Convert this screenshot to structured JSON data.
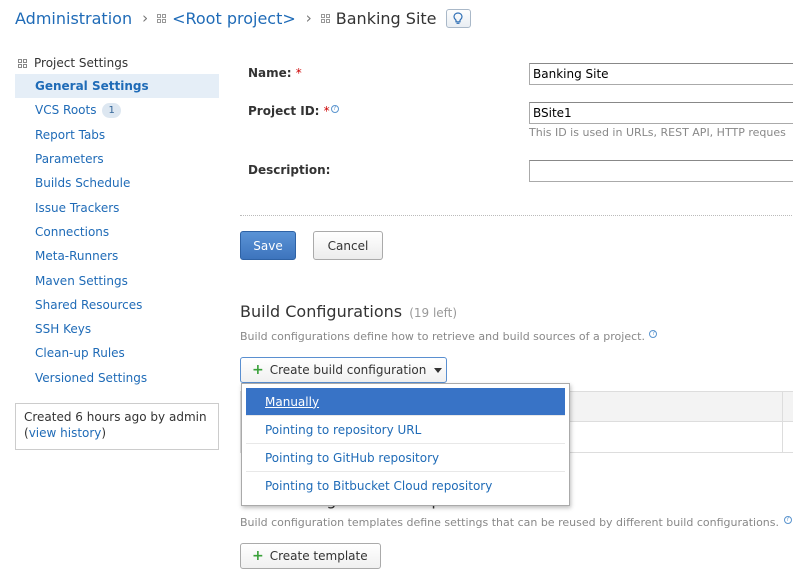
{
  "breadcrumb": {
    "admin": "Administration",
    "root": "<Root project>",
    "current": "Banking Site",
    "separator": "›"
  },
  "sidebar": {
    "header": "Project Settings",
    "items": [
      {
        "label": "General Settings",
        "active": true
      },
      {
        "label": "VCS Roots",
        "badge": "1"
      },
      {
        "label": "Report Tabs"
      },
      {
        "label": "Parameters"
      },
      {
        "label": "Builds Schedule"
      },
      {
        "label": "Issue Trackers"
      },
      {
        "label": "Connections"
      },
      {
        "label": "Meta-Runners"
      },
      {
        "label": "Maven Settings"
      },
      {
        "label": "Shared Resources"
      },
      {
        "label": "SSH Keys"
      },
      {
        "label": "Clean-up Rules"
      },
      {
        "label": "Versioned Settings"
      }
    ],
    "info": {
      "created": "Created 6 hours ago  by admin",
      "open_paren": "(",
      "history_link": "view history",
      "close_paren": ")"
    }
  },
  "form": {
    "name_label": "Name:",
    "name_value": "Banking Site",
    "project_id_label": "Project ID:",
    "project_id_value": "BSite1",
    "project_id_note": "This ID is used in URLs, REST API, HTTP reques",
    "description_label": "Description:",
    "description_value": "",
    "required_mark": "*",
    "save_label": "Save",
    "cancel_label": "Cancel"
  },
  "build_configurations": {
    "title": "Build Configurations",
    "count": "(19 left)",
    "description": "Build configurations define how to retrieve and build sources of a project.",
    "create_button": "Create build configuration",
    "dropdown": [
      {
        "label": "Manually",
        "selected": true
      },
      {
        "label": "Pointing to repository URL"
      },
      {
        "label": "Pointing to GitHub repository"
      },
      {
        "label": "Pointing to Bitbucket Cloud repository"
      }
    ]
  },
  "templates": {
    "title": "Build Configuration Templates",
    "description": "Build configuration templates define settings that can be reused by different build configurations.",
    "create_button": "Create template"
  },
  "icons": {
    "plus": "+",
    "help": "?",
    "bulb": "☀"
  },
  "colors": {
    "link": "#1f6bb7",
    "primary_button": "#3d74bd",
    "selected_item": "#3873c6",
    "required": "#cc0000"
  }
}
